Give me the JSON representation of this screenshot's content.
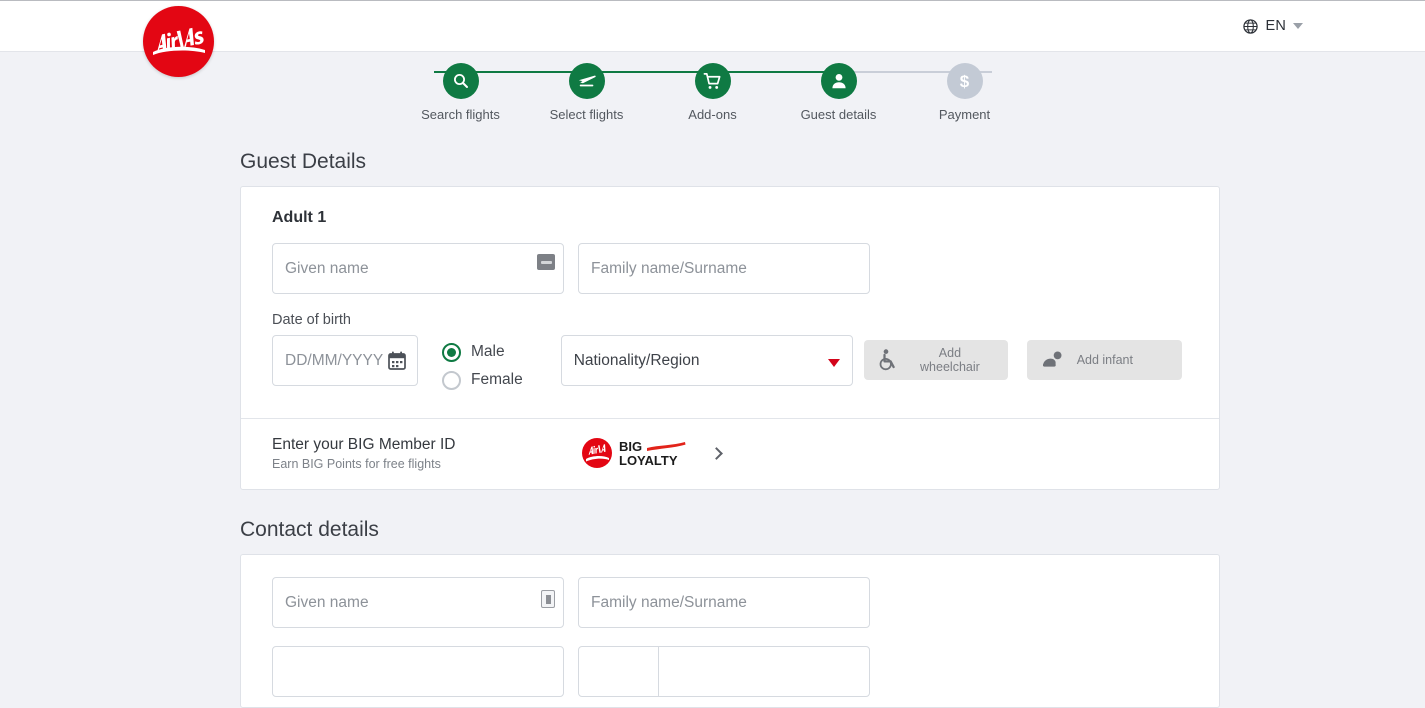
{
  "header": {
    "logo_alt": "AirAsia",
    "language": {
      "code": "EN",
      "icon": "globe-icon",
      "caret": "chevron-down-icon"
    }
  },
  "stepper": {
    "steps": [
      {
        "label": "Search flights",
        "icon": "search-icon",
        "state": "done"
      },
      {
        "label": "Select flights",
        "icon": "plane-icon",
        "state": "done"
      },
      {
        "label": "Add-ons",
        "icon": "cart-icon",
        "state": "done"
      },
      {
        "label": "Guest details",
        "icon": "person-icon",
        "state": "current"
      },
      {
        "label": "Payment",
        "icon": "dollar-icon",
        "state": "upcoming"
      }
    ],
    "colors": {
      "active": "#0f7a43",
      "inactive": "#c3cad5"
    }
  },
  "guest_details": {
    "heading": "Guest Details",
    "adult": {
      "title": "Adult 1",
      "given_name_placeholder": "Given name",
      "family_name_placeholder": "Family name/Surname",
      "dob_label": "Date of birth",
      "dob_placeholder": "DD/MM/YYYY",
      "gender": {
        "male_label": "Male",
        "female_label": "Female",
        "selected": "Male"
      },
      "nationality_placeholder": "Nationality/Region",
      "wheelchair_button": "Add wheelchair",
      "infant_button": "Add infant"
    },
    "big_member": {
      "title": "Enter your BIG Member ID",
      "subtitle": "Earn BIG Points for free flights",
      "logo_line1": "BIG",
      "logo_line2": "LOYALTY"
    }
  },
  "contact_details": {
    "heading": "Contact details",
    "given_name_placeholder": "Given name",
    "family_name_placeholder": "Family name/Surname"
  },
  "colors": {
    "brand_red": "#e30613",
    "brand_green": "#0f7a43",
    "page_bg": "#f1f2f6"
  }
}
